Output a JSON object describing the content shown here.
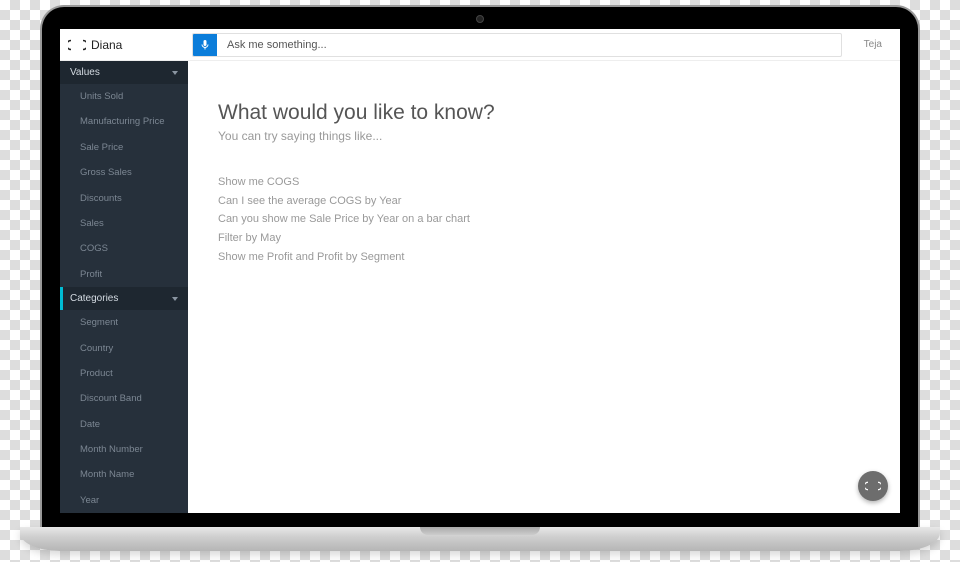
{
  "brand": {
    "name": "Diana"
  },
  "header": {
    "search_placeholder": "Ask me something...",
    "user": "Teja"
  },
  "sidebar": {
    "sections": [
      {
        "label": "Values",
        "items": [
          "Units Sold",
          "Manufacturing Price",
          "Sale Price",
          "Gross Sales",
          "Discounts",
          "Sales",
          "COGS",
          "Profit"
        ]
      },
      {
        "label": "Categories",
        "items": [
          "Segment",
          "Country",
          "Product",
          "Discount Band",
          "Date",
          "Month Number",
          "Month Name",
          "Year"
        ]
      }
    ]
  },
  "main": {
    "heading": "What would you like to know?",
    "subheading": "You can try saying things like...",
    "suggestions": [
      "Show me COGS",
      "Can I see the average COGS by Year",
      "Can you show me Sale Price by Year on a bar chart",
      "Filter by May",
      "Show me Profit and Profit by Segment"
    ]
  }
}
